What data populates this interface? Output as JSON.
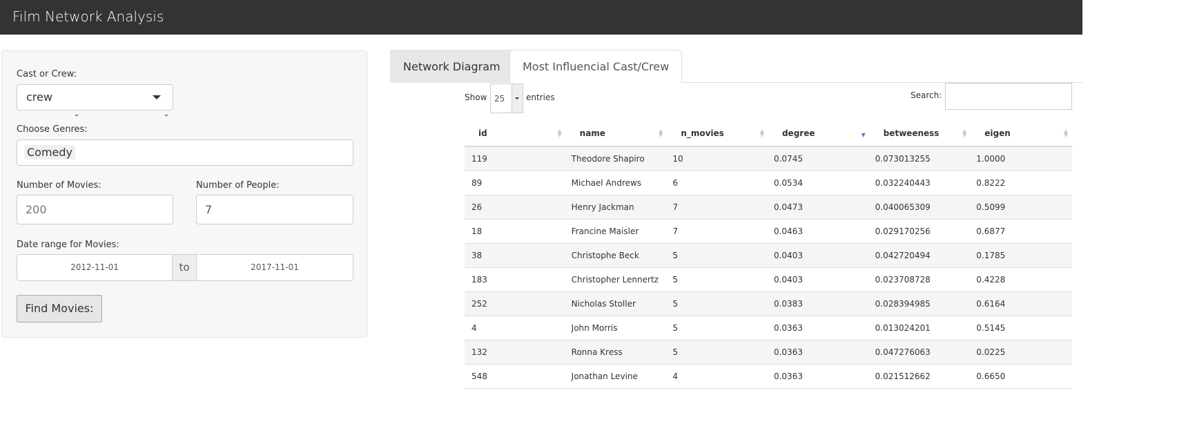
{
  "app": {
    "title": "Film Network Analysis"
  },
  "sidebar": {
    "cast_or_crew": {
      "label": "Cast or Crew:",
      "value": "crew"
    },
    "genres": {
      "label": "Choose Genres:",
      "selected": [
        "Comedy"
      ]
    },
    "num_movies": {
      "label": "Number of Movies:",
      "value": "200"
    },
    "num_people": {
      "label": "Number of People:",
      "value": "7"
    },
    "date_range": {
      "label": "Date range for Movies:",
      "start": "2012-11-01",
      "sep": "to",
      "end": "2017-11-01"
    },
    "find_button": "Find Movies:"
  },
  "tabs": [
    {
      "label": "Network Diagram",
      "active": false
    },
    {
      "label": "Most Influencial Cast/Crew",
      "active": true
    }
  ],
  "table": {
    "show_label": "Show",
    "entries_value": "25",
    "entries_label": "entries",
    "search_label": "Search:",
    "search_value": "",
    "columns": [
      "id",
      "name",
      "n_movies",
      "degree",
      "betweeness",
      "eigen"
    ],
    "sorted_column": "degree",
    "sort_direction": "desc",
    "sort_color": "#7070e0",
    "rows": [
      [
        "119",
        "Theodore Shapiro",
        "10",
        "0.0745",
        "0.073013255",
        "1.0000"
      ],
      [
        "89",
        "Michael Andrews",
        "6",
        "0.0534",
        "0.032240443",
        "0.8222"
      ],
      [
        "26",
        "Henry Jackman",
        "7",
        "0.0473",
        "0.040065309",
        "0.5099"
      ],
      [
        "18",
        "Francine Maisler",
        "7",
        "0.0463",
        "0.029170256",
        "0.6877"
      ],
      [
        "38",
        "Christophe Beck",
        "5",
        "0.0403",
        "0.042720494",
        "0.1785"
      ],
      [
        "183",
        "Christopher Lennertz",
        "5",
        "0.0403",
        "0.023708728",
        "0.4228"
      ],
      [
        "252",
        "Nicholas Stoller",
        "5",
        "0.0383",
        "0.028394985",
        "0.6164"
      ],
      [
        "4",
        "John Morris",
        "5",
        "0.0363",
        "0.013024201",
        "0.5145"
      ],
      [
        "132",
        "Ronna Kress",
        "5",
        "0.0363",
        "0.047276063",
        "0.0225"
      ],
      [
        "548",
        "Jonathan Levine",
        "4",
        "0.0363",
        "0.021512662",
        "0.6650"
      ]
    ]
  }
}
